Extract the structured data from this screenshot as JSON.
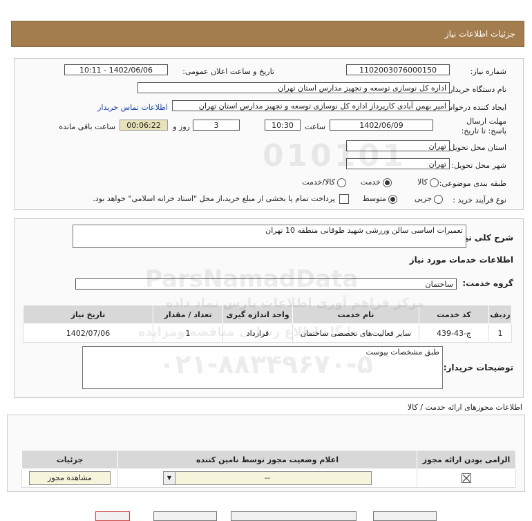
{
  "header": {
    "title": "جزئیات اطلاعات نیاز"
  },
  "form": {
    "need_number_label": "شماره نیاز:",
    "need_number": "1102003076000150",
    "announce_label": "تاریخ و ساعت اعلان عمومی:",
    "announce_value": "1402/06/06 - 10:11",
    "buyer_org_label": "نام دستگاه خریدار:",
    "buyer_org": "اداره کل نوسازی  توسعه و تجهیز مدارس استان تهران",
    "creator_label": "ایجاد کننده درخواست:",
    "creator": "امیر بهمن آبادی کارپرداز اداره کل نوسازی  توسعه و تجهیز مدارس استان تهران",
    "contact_link": "اطلاعات تماس خریدار",
    "deadline_label": "مهلت ارسال پاسخ: تا تاریخ:",
    "deadline_date": "1402/06/09",
    "time_label": "ساعت",
    "deadline_time": "10:30",
    "days_value": "3",
    "days_label": "روز و",
    "remaining_time": "00:06:22",
    "remaining_label": "ساعت باقی مانده",
    "province_label": "استان محل تحویل:",
    "province": "تهران",
    "city_label": "شهر محل تحویل:",
    "city": "تهران",
    "category_label": "طبقه بندی موضوعی:",
    "category_options": [
      "کالا",
      "خدمت",
      "کالا/خدمت"
    ],
    "process_label": "نوع فرآیند خرید :",
    "process_options": [
      "جزیی",
      "متوسط"
    ],
    "payment_note": "پرداخت تمام یا بخشی از مبلغ خرید،از محل \"اسناد خزانه اسلامی\" خواهد بود."
  },
  "summary": {
    "desc_label": "شرح کلی نیاز:",
    "desc": "تعمیرات اساسی سالن ورزشی شهید طوقانی منطقه 10 تهران",
    "services_title": "اطلاعات خدمات مورد نیاز",
    "group_label": "گروه خدمت:",
    "group_value": "ساختمان",
    "table_headers": [
      "ردیف",
      "کد خدمت",
      "نام خدمت",
      "واحد اندازه گیری",
      "تعداد / مقدار",
      "تاریخ نیاز"
    ],
    "table_rows": [
      [
        "1",
        "ج-43-439",
        "سایر فعالیت‌های تخصصی ساختمان",
        "قرارداد",
        "1",
        "1402/07/06"
      ]
    ],
    "buyer_notes_label": "توضیحات خریدار:",
    "buyer_notes": "طبق مشخصات پیوست"
  },
  "permits": {
    "title": "اطلاعات مجوزهای ارائه خدمت / کالا",
    "headers": [
      "الزامی بودن ارائه مجوز",
      "اعلام وضعیت مجوز توسط نامین کننده",
      "جزئیات"
    ],
    "select_value": "--",
    "view_button": "مشاهده مجوز"
  },
  "watermark": {
    "digits": "010101",
    "brand": "ParsNamadData",
    "line1": "مرکز فراهم آوری اطلاعات پارس نماد داده",
    "line2": "پایگاه اطلاع رسانی مناقصه ومزایده",
    "phone": "۰۲۱-۸۸۳۴۹۶۷۰-۵"
  },
  "colors": {
    "header_bg": "#a47d4e",
    "link": "#1a44b8",
    "remaining_bg": "#e8e2b8"
  }
}
